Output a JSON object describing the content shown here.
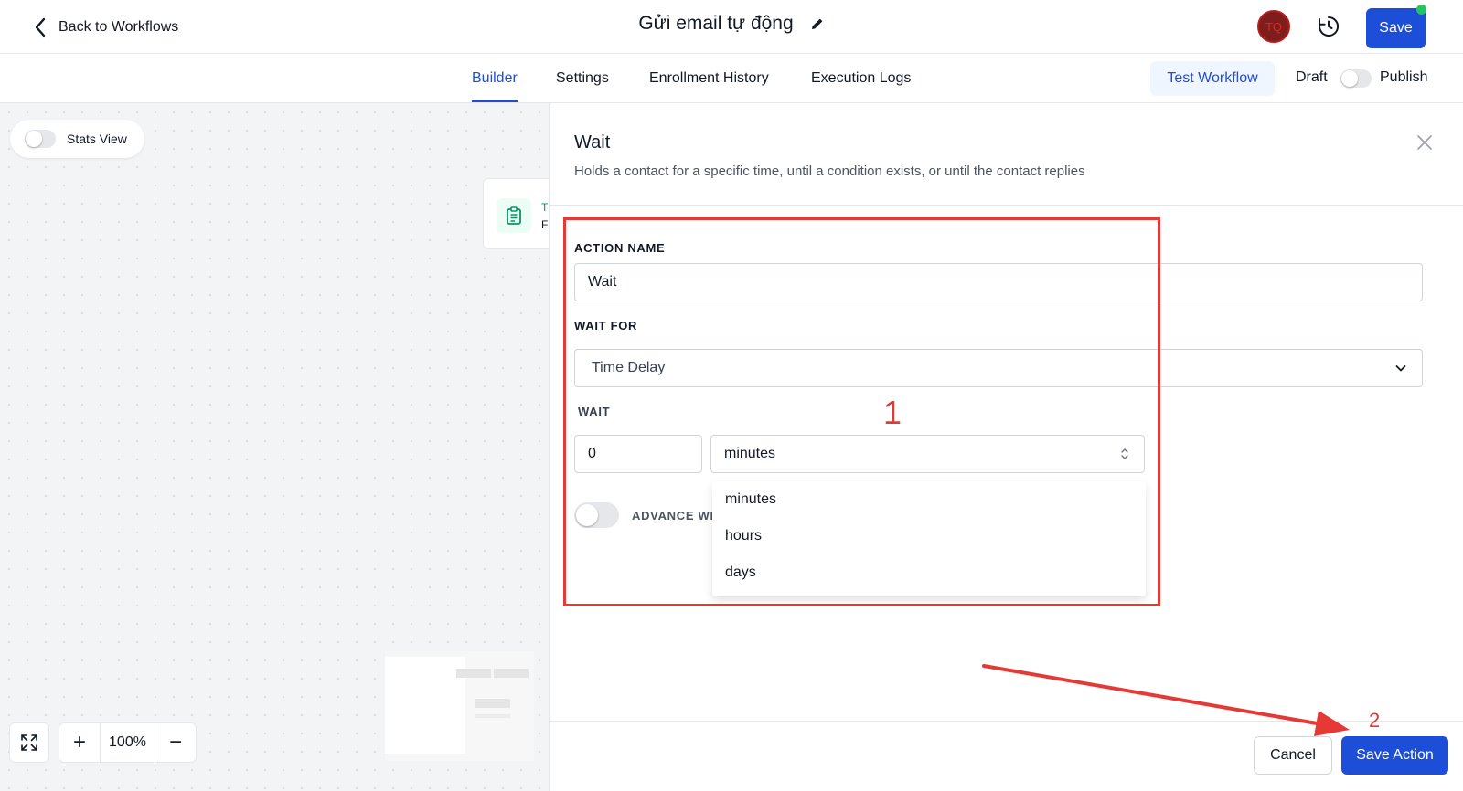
{
  "header": {
    "back_label": "Back to Workflows",
    "workflow_title": "Gửi email tự động",
    "avatar_initials": "TQ",
    "save_label": "Save"
  },
  "tabs": [
    {
      "label": "Builder",
      "active": true
    },
    {
      "label": "Settings",
      "active": false
    },
    {
      "label": "Enrollment History",
      "active": false
    },
    {
      "label": "Execution Logs",
      "active": false
    }
  ],
  "toolbar": {
    "test_label": "Test Workflow",
    "draft_label": "Draft",
    "publish_label": "Publish",
    "publish_on": false
  },
  "canvas": {
    "stats_label": "Stats View",
    "stats_on": false,
    "node_line1": "T",
    "node_line2": "F",
    "zoom": "100%",
    "zoom_in": "+",
    "zoom_out": "−"
  },
  "panel": {
    "title": "Wait",
    "subtitle": "Holds a contact for a specific time, until a condition exists, or until the contact replies",
    "action_name_label": "ACTION NAME",
    "action_name_value": "Wait",
    "wait_for_label": "WAIT FOR",
    "wait_for_value": "Time Delay",
    "wait_label": "WAIT",
    "wait_amount": "0",
    "wait_unit": "minutes",
    "advanced_label": "ADVANCE WI",
    "unit_options": [
      "minutes",
      "hours",
      "days"
    ],
    "cancel_label": "Cancel",
    "save_action_label": "Save Action"
  },
  "annotations": {
    "box_number": "1",
    "arrow_number": "2",
    "color": "#e53935"
  },
  "colors": {
    "primary": "#1d4ed8",
    "status_green": "#22c55e",
    "node_green": "#059669"
  }
}
